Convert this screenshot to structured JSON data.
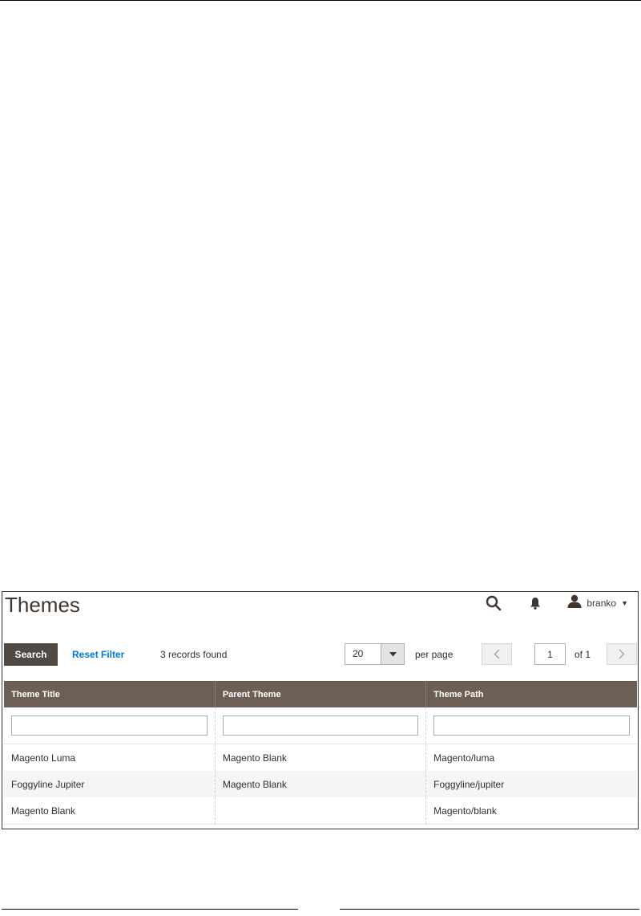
{
  "header": {
    "title": "Themes",
    "user_name": "branko",
    "icons": [
      "search-icon",
      "bell-icon",
      "user-icon",
      "caret-down-icon"
    ]
  },
  "toolbar": {
    "search_label": "Search",
    "reset_label": "Reset Filter",
    "records_text": "3 records found",
    "per_page_value": "20",
    "per_page_label": "per page",
    "current_page": "1",
    "page_total_text": "of 1"
  },
  "grid": {
    "columns": [
      "Theme Title",
      "Parent Theme",
      "Theme Path"
    ],
    "rows": [
      [
        "Magento Luma",
        "Magento Blank",
        "Magento/luma"
      ],
      [
        "Foggyline Jupiter",
        "Magento Blank",
        "Foggyline/jupiter"
      ],
      [
        "Magento Blank",
        "",
        "Magento/blank"
      ]
    ]
  },
  "colors": {
    "header_bg": "#6d5f55",
    "primary_button": "#514943",
    "link": "#007bdb"
  }
}
